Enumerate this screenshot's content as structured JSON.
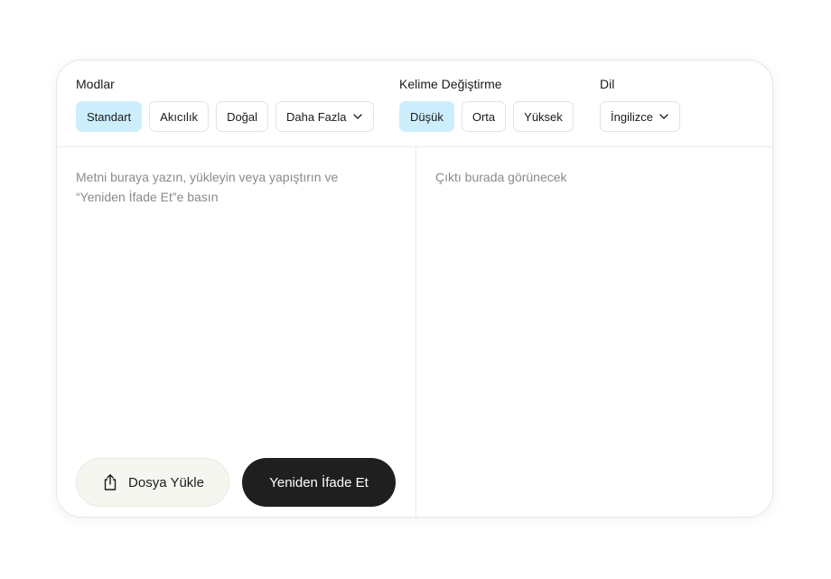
{
  "modes": {
    "title": "Modlar",
    "options": [
      "Standart",
      "Akıcılık",
      "Doğal"
    ],
    "active": "Standart",
    "more_label": "Daha Fazla"
  },
  "word_change": {
    "title": "Kelime Değiştirme",
    "options": [
      "Düşük",
      "Orta",
      "Yüksek"
    ],
    "active": "Düşük"
  },
  "language": {
    "title": "Dil",
    "selected": "İngilizce"
  },
  "input": {
    "placeholder": "Metni buraya yazın, yükleyin veya yapıştırın ve “Yeniden İfade Et”e basın"
  },
  "output": {
    "placeholder": "Çıktı burada görünecek"
  },
  "actions": {
    "upload_label": "Dosya Yükle",
    "rephrase_label": "Yeniden İfade Et"
  },
  "colors": {
    "active_chip": "#cdeefd",
    "primary_button": "#1f1f1f",
    "upload_button": "#f6f6f0"
  },
  "icons": {
    "upload": "upload-icon",
    "dropdown": "chevron-down-icon"
  }
}
